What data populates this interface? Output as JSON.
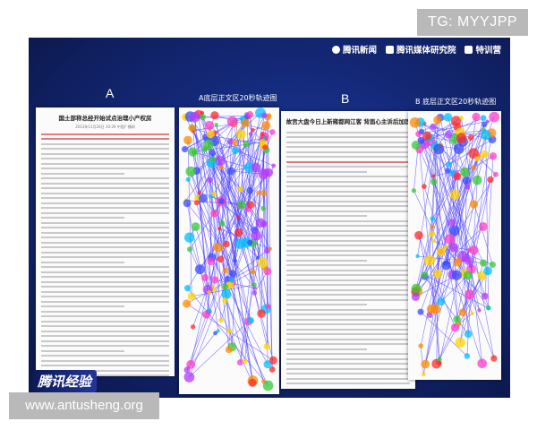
{
  "watermark_top": "TG: MYYJPP",
  "watermark_bottom": "www.antusheng.org",
  "slide": {
    "logos": [
      "腾讯新闻",
      "腾讯媒体研究院",
      "特训营"
    ],
    "label_a": "A",
    "label_a_heatmap": "A底层正文区20秒轨迹图",
    "label_b": "B",
    "label_b_heatmap": "B 底层正文区20秒轨迹图",
    "brand": "腾讯经验",
    "doc_a": {
      "title": "国土部称总经开始试点治理小产权房",
      "meta": "2013年11月26日 10:29 中国广播网"
    },
    "doc_b": {
      "title": "故宫大盘今日上新雍都网江客 背面心主诉后加固"
    }
  }
}
